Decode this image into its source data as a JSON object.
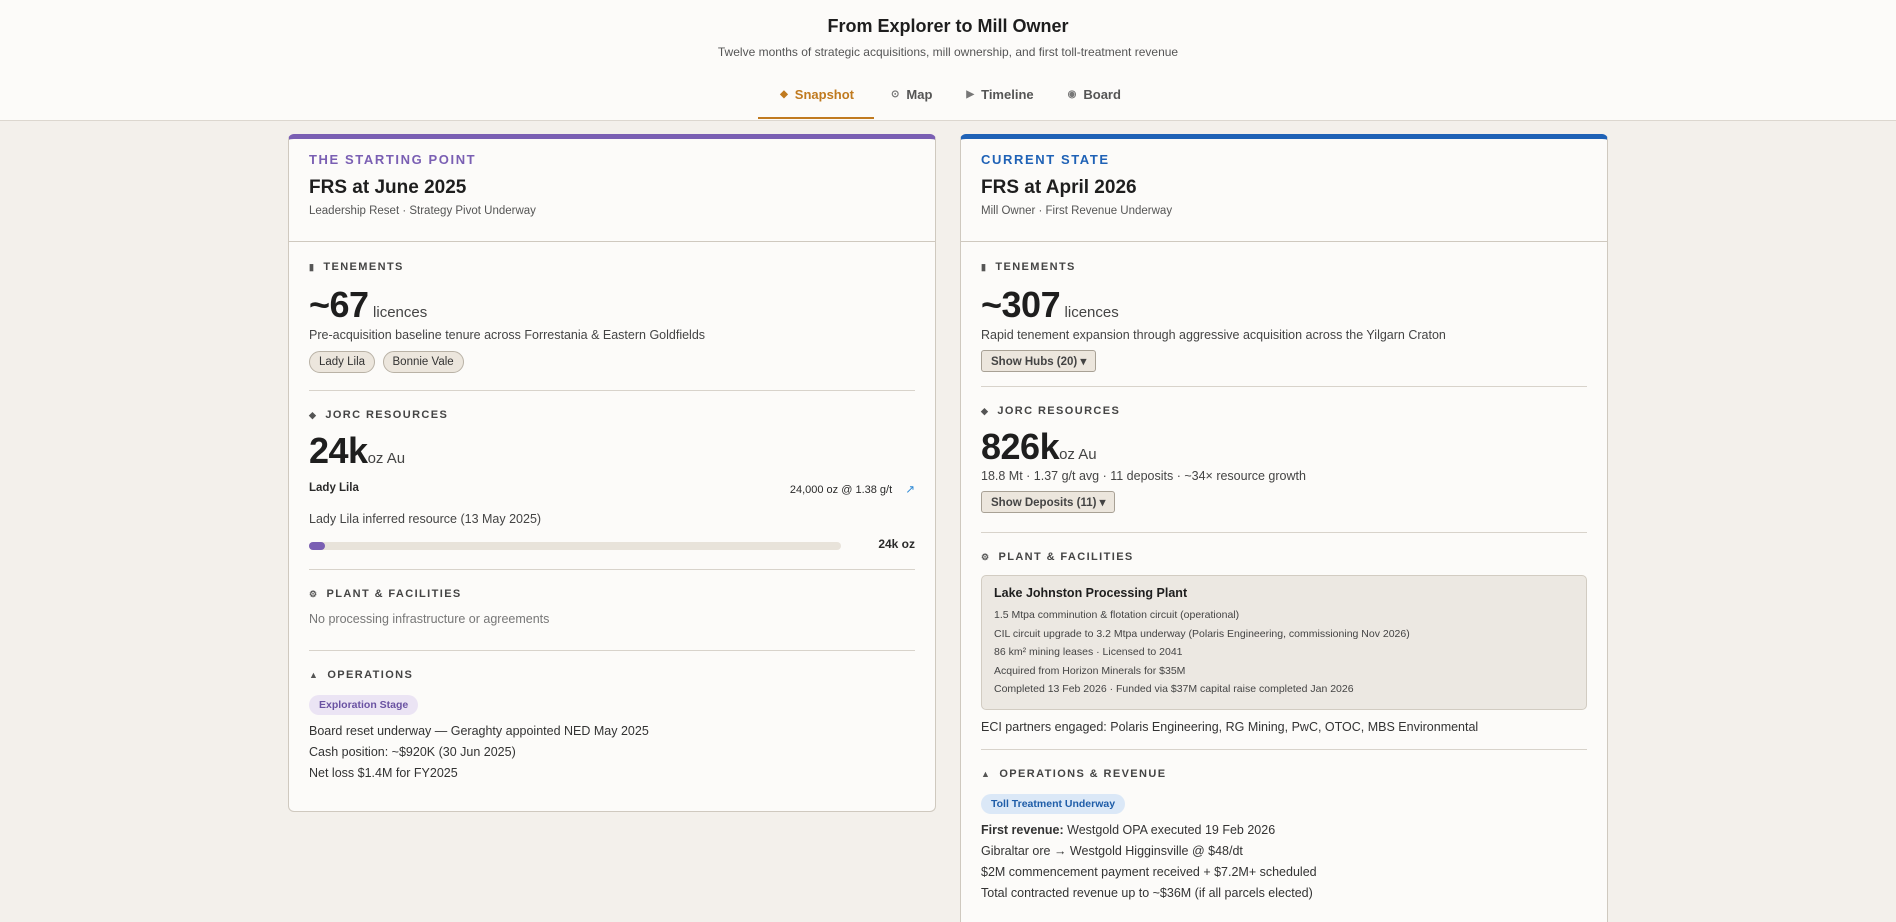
{
  "header": {
    "title": "From Explorer to Mill Owner",
    "subtitle": "Twelve months of strategic acquisitions, mill ownership, and first toll-treatment revenue"
  },
  "tabs": [
    {
      "label": "Snapshot",
      "icon": "diamond-icon",
      "active": true
    },
    {
      "label": "Map",
      "icon": "compass-icon",
      "active": false
    },
    {
      "label": "Timeline",
      "icon": "play-icon",
      "active": false
    },
    {
      "label": "Board",
      "icon": "circle-icon",
      "active": false
    }
  ],
  "colors": {
    "accent": "#c07a1f",
    "start": "#7a5fb3",
    "current": "#1f62b6"
  },
  "left": {
    "eyebrow": "THE STARTING POINT",
    "title": "FRS at June 2025",
    "subtitle": "Leadership Reset · Strategy Pivot Underway",
    "tenements": {
      "label": "TENEMENTS",
      "value": "~67",
      "unit": "licences",
      "desc": "Pre-acquisition baseline tenure across Forrestania & Eastern Goldfields",
      "chips": [
        "Lady Lila",
        "Bonnie Vale"
      ]
    },
    "jorc": {
      "label": "JORC RESOURCES",
      "value": "24k",
      "unit": "oz Au",
      "deposit_name": "Lady Lila",
      "deposit_detail": "24,000 oz @ 1.38 g/t",
      "deposit_link_icon": "↗",
      "deposit_desc": "Lady Lila inferred resource (13 May 2025)",
      "bar_value": "24k oz",
      "bar_fraction": 0.03
    },
    "plant": {
      "label": "PLANT & FACILITIES",
      "text": "No processing infrastructure or agreements"
    },
    "ops": {
      "label": "OPERATIONS",
      "badge": "Exploration Stage",
      "lines": [
        "Board reset underway — Geraghty appointed NED May 2025",
        "Cash position: ~$920K (30 Jun 2025)",
        "Net loss $1.4M for FY2025"
      ]
    }
  },
  "right": {
    "eyebrow": "CURRENT STATE",
    "title": "FRS at April 2026",
    "subtitle": "Mill Owner · First Revenue Underway",
    "tenements": {
      "label": "TENEMENTS",
      "value": "~307",
      "unit": "licences",
      "desc": "Rapid tenement expansion through aggressive acquisition across the Yilgarn Craton",
      "dropdown": "Show Hubs  (20)  ▾"
    },
    "jorc": {
      "label": "JORC RESOURCES",
      "value": "826k",
      "unit": "oz Au",
      "desc": "18.8 Mt · 1.37 g/t avg · 11 deposits · ~34× resource growth",
      "dropdown": "Show Deposits  (11)  ▾"
    },
    "plant": {
      "label": "PLANT & FACILITIES",
      "name": "Lake Johnston Processing Plant",
      "lines": [
        "1.5 Mtpa comminution & flotation circuit (operational)",
        "CIL circuit upgrade to 3.2 Mtpa underway (Polaris Engineering, commissioning Nov 2026)",
        "86 km² mining leases · Licensed to 2041",
        "Acquired from Horizon Minerals for $35M",
        "Completed 13 Feb 2026 · Funded via $37M capital raise completed Jan 2026"
      ],
      "eci": "ECI partners engaged: Polaris Engineering, RG Mining, PwC, OTOC, MBS Environmental"
    },
    "ops": {
      "label": "OPERATIONS & REVENUE",
      "badge": "Toll Treatment Underway",
      "first_revenue_label": "First revenue:",
      "first_revenue_text": " Westgold OPA executed 19 Feb 2026",
      "lines": [
        "Gibraltar ore → Westgold Higginsville @ $48/dt",
        "$2M commencement payment received + $7.2M+ scheduled",
        "Total contracted revenue up to ~$36M (if all parcels elected)"
      ]
    }
  }
}
